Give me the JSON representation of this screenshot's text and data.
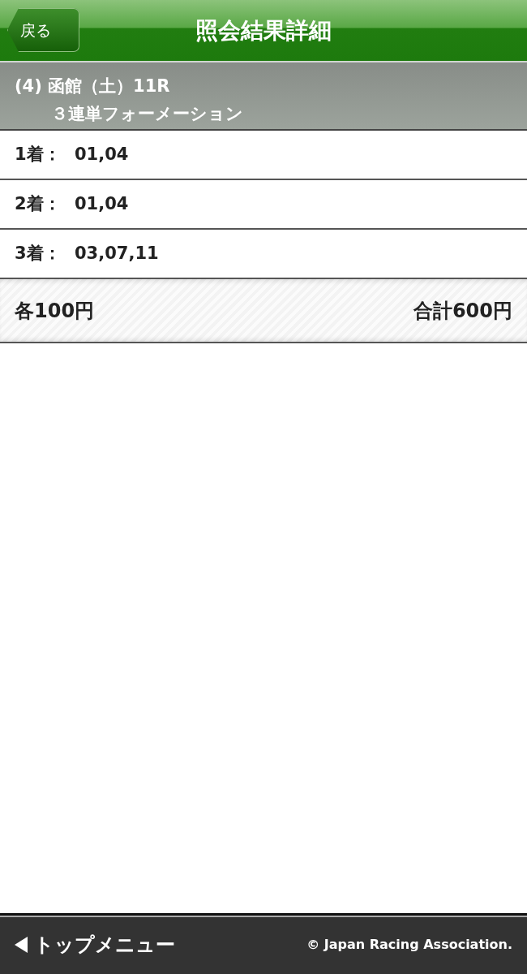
{
  "header": {
    "back_button": "戻る",
    "title": "照会結果詳細"
  },
  "race": {
    "line_1": "(4) 函館（土）11R",
    "line_2": "３連単フォーメーション"
  },
  "rows": [
    {
      "label": "1着：",
      "value": "01,04"
    },
    {
      "label": "2着：",
      "value": "01,04"
    },
    {
      "label": "3着：",
      "value": "03,07,11"
    }
  ],
  "summary": {
    "each": "各100円",
    "total": "合計600円"
  },
  "footer": {
    "top_menu": "トップメニュー",
    "copyright": "© Japan Racing Association."
  }
}
